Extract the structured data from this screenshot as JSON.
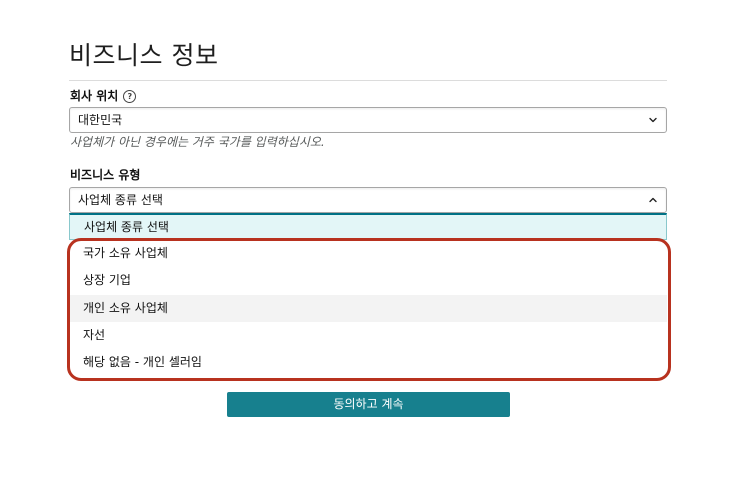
{
  "page": {
    "title": "비즈니스 정보"
  },
  "company_location": {
    "label": "회사 위치",
    "help_icon": "?",
    "selected_value": "대한민국",
    "hint": "사업체가 아닌 경우에는 거주 국가를 입력하십시오."
  },
  "business_type": {
    "label": "비즈니스 유형",
    "selected_value": "사업체 종류 선택",
    "options": [
      {
        "label": "사업체 종류 선택",
        "state": "selected"
      },
      {
        "label": "국가 소유 사업체",
        "state": "normal"
      },
      {
        "label": "상장 기업",
        "state": "normal"
      },
      {
        "label": "개인 소유 사업체",
        "state": "hover"
      },
      {
        "label": "자선",
        "state": "normal"
      },
      {
        "label": "해당 없음 - 개인 셀러임",
        "state": "normal"
      }
    ]
  },
  "actions": {
    "continue_label": "동의하고 계속"
  },
  "colors": {
    "primary_button": "#17808e",
    "highlight_frame": "#b8321f",
    "selected_option_bg": "#e3f6f7"
  },
  "icons": {
    "location_chevron": "chevron-down-icon",
    "type_chevron": "chevron-up-icon",
    "help": "question-circle-icon"
  }
}
